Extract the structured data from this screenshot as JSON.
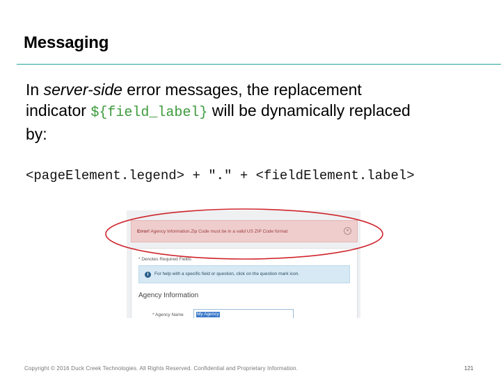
{
  "slide": {
    "title": "Messaging",
    "body": {
      "line1_prefix": "In ",
      "line1_em": "server-side",
      "line1_suffix": " error messages, the replacement",
      "line2_prefix": "indicator ",
      "code_token": "${field_label}",
      "line2_suffix": " will be dynamically replaced",
      "line3": "by:"
    },
    "formula": "<pageElement.legend> + \".\" + <fieldElement.label>",
    "footer": "Copyright © 2016 Duck Creek Technologies. All Rights Reserved. Confidential and Proprietary Information.",
    "page_number": "121"
  },
  "screenshot": {
    "error_label": "Error!",
    "error_message": " Agency Information.Zip Code must be in a valid US ZIP Code format",
    "required_note": "* Denotes Required Fields",
    "help_text": "For help with a specific field or question, click on the question mark icon.",
    "section_title": "Agency Information",
    "field_label": "* Agency Name",
    "field_value": "My Agency"
  },
  "colors": {
    "accent_rule": "#2aa39a",
    "code_green": "#3c9b3c",
    "highlight_red": "#d0242c",
    "error_bg": "#efcdcd",
    "info_bg": "#d6e9f4"
  },
  "icons": {
    "close": "close-circle-icon",
    "info": "info-icon"
  }
}
